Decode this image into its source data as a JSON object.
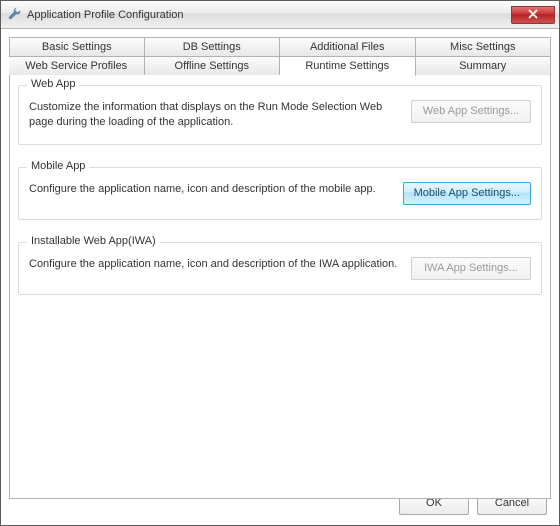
{
  "window": {
    "title": "Application Profile Configuration"
  },
  "tabs": {
    "row1": [
      {
        "label": "Basic Settings"
      },
      {
        "label": "DB Settings"
      },
      {
        "label": "Additional Files"
      },
      {
        "label": "Misc Settings"
      }
    ],
    "row2": [
      {
        "label": "Web Service Profiles"
      },
      {
        "label": "Offline Settings"
      },
      {
        "label": "Runtime Settings",
        "active": true
      },
      {
        "label": "Summary"
      }
    ]
  },
  "groups": {
    "webApp": {
      "legend": "Web App",
      "desc": "Customize the information that displays on the Run Mode Selection Web page during the loading of the application.",
      "button": "Web App Settings..."
    },
    "mobileApp": {
      "legend": "Mobile App",
      "desc": "Configure the application name, icon and description of the mobile app.",
      "button": "Mobile App Settings..."
    },
    "iwaApp": {
      "legend": "Installable Web App(IWA)",
      "desc": "Configure the application name, icon and description of the IWA application.",
      "button": "IWA App Settings..."
    }
  },
  "footer": {
    "ok": "OK",
    "cancel": "Cancel"
  }
}
